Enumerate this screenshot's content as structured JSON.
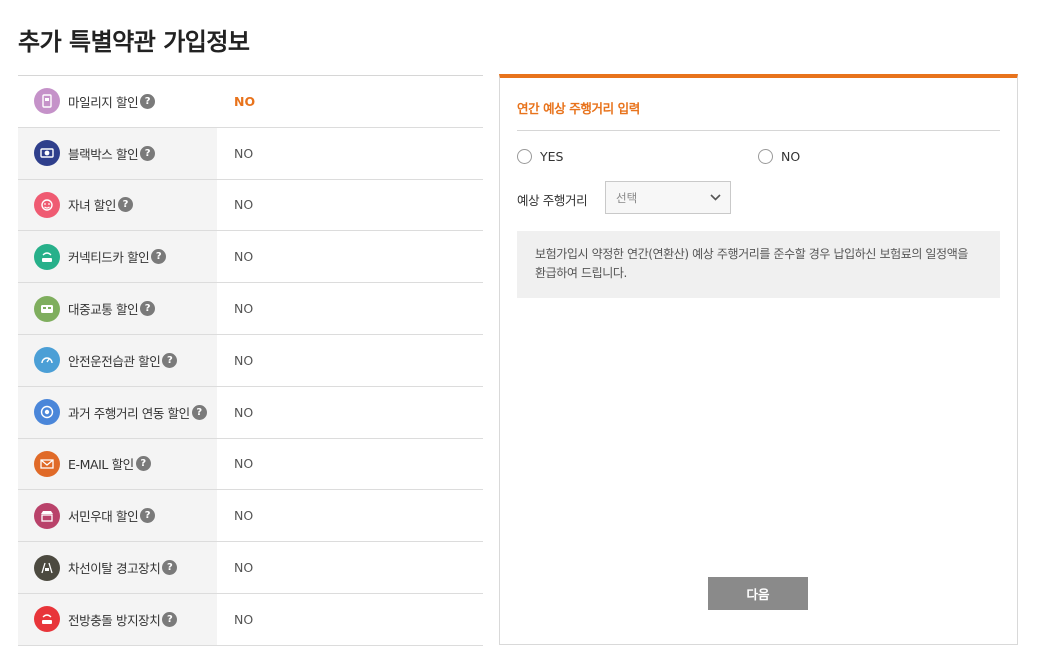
{
  "page": {
    "title": "추가 특별약관 가입정보"
  },
  "discounts": [
    {
      "label": "마일리지 할인",
      "value": "NO",
      "icon": "mileage-icon",
      "color": "#c592c9",
      "active": true
    },
    {
      "label": "블랙박스 할인",
      "value": "NO",
      "icon": "blackbox-icon",
      "color": "#2f3f8c",
      "active": false
    },
    {
      "label": "자녀 할인",
      "value": "NO",
      "icon": "child-icon",
      "color": "#ef5b72",
      "active": false
    },
    {
      "label": "커넥티드카 할인",
      "value": "NO",
      "icon": "connected-car-icon",
      "color": "#27b08a",
      "active": false
    },
    {
      "label": "대중교통 할인",
      "value": "NO",
      "icon": "bus-icon",
      "color": "#7fae5e",
      "active": false
    },
    {
      "label": "안전운전습관 할인",
      "value": "NO",
      "icon": "speedometer-icon",
      "color": "#4b9fd6",
      "active": false
    },
    {
      "label": "과거 주행거리 연동 할인",
      "value": "NO",
      "icon": "target-icon",
      "color": "#4a86d9",
      "active": false
    },
    {
      "label": "E-MAIL 할인",
      "value": "NO",
      "icon": "email-icon",
      "color": "#e06a28",
      "active": false
    },
    {
      "label": "서민우대 할인",
      "value": "NO",
      "icon": "shop-icon",
      "color": "#b9426a",
      "active": false
    },
    {
      "label": "차선이탈 경고장치",
      "value": "NO",
      "icon": "lane-departure-icon",
      "color": "#4c4a40",
      "active": false
    },
    {
      "label": "전방충돌 방지장치",
      "value": "NO",
      "icon": "collision-warning-icon",
      "color": "#e8353a",
      "active": false
    }
  ],
  "help_symbol": "?",
  "mileage_panel": {
    "title": "연간 예상 주행거리 입력",
    "yes_label": "YES",
    "no_label": "NO",
    "distance_label": "예상 주행거리",
    "select_placeholder": "선택",
    "info_text": "보험가입시 약정한 연간(연환산) 예상 주행거리를 준수할 경우 납입하신 보험료의 일정액을 환급하여 드립니다.",
    "next_label": "다음"
  },
  "colors": {
    "accent": "#e8731c",
    "button": "#8a8a8a"
  }
}
